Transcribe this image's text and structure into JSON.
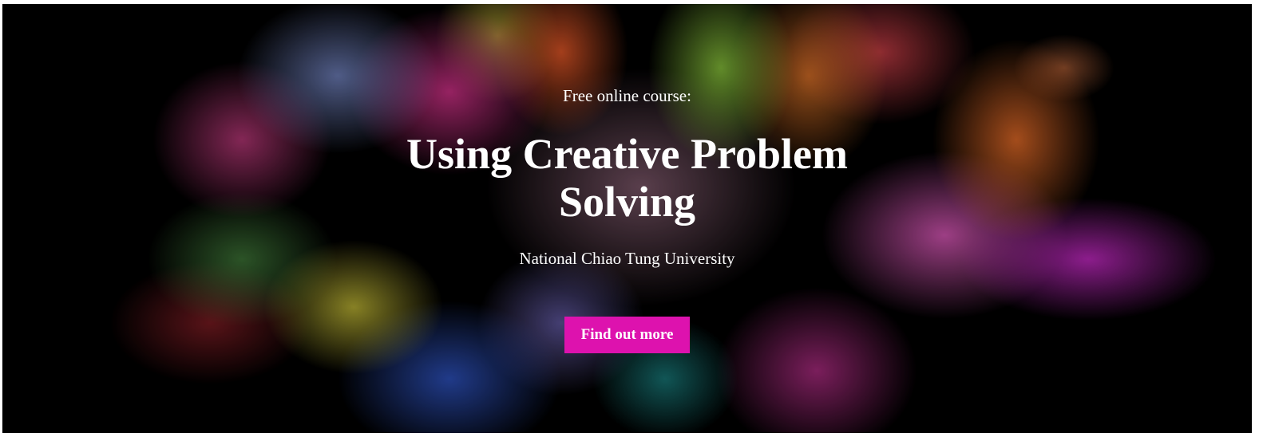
{
  "hero": {
    "eyebrow": "Free online course:",
    "title": "Using Creative Problem Solving",
    "provider": "National Chiao Tung University",
    "cta_label": "Find out more",
    "cta_color": "#dd12ae",
    "text_color": "#ffffff",
    "background_color": "#000000"
  }
}
